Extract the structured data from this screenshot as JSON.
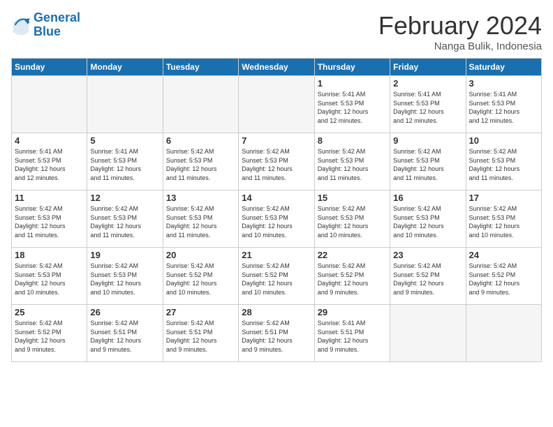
{
  "logo": {
    "line1": "General",
    "line2": "Blue"
  },
  "title": "February 2024",
  "subtitle": "Nanga Bulik, Indonesia",
  "days_of_week": [
    "Sunday",
    "Monday",
    "Tuesday",
    "Wednesday",
    "Thursday",
    "Friday",
    "Saturday"
  ],
  "weeks": [
    [
      {
        "day": "",
        "info": ""
      },
      {
        "day": "",
        "info": ""
      },
      {
        "day": "",
        "info": ""
      },
      {
        "day": "",
        "info": ""
      },
      {
        "day": "1",
        "info": "Sunrise: 5:41 AM\nSunset: 5:53 PM\nDaylight: 12 hours\nand 12 minutes."
      },
      {
        "day": "2",
        "info": "Sunrise: 5:41 AM\nSunset: 5:53 PM\nDaylight: 12 hours\nand 12 minutes."
      },
      {
        "day": "3",
        "info": "Sunrise: 5:41 AM\nSunset: 5:53 PM\nDaylight: 12 hours\nand 12 minutes."
      }
    ],
    [
      {
        "day": "4",
        "info": "Sunrise: 5:41 AM\nSunset: 5:53 PM\nDaylight: 12 hours\nand 12 minutes."
      },
      {
        "day": "5",
        "info": "Sunrise: 5:41 AM\nSunset: 5:53 PM\nDaylight: 12 hours\nand 11 minutes."
      },
      {
        "day": "6",
        "info": "Sunrise: 5:42 AM\nSunset: 5:53 PM\nDaylight: 12 hours\nand 11 minutes."
      },
      {
        "day": "7",
        "info": "Sunrise: 5:42 AM\nSunset: 5:53 PM\nDaylight: 12 hours\nand 11 minutes."
      },
      {
        "day": "8",
        "info": "Sunrise: 5:42 AM\nSunset: 5:53 PM\nDaylight: 12 hours\nand 11 minutes."
      },
      {
        "day": "9",
        "info": "Sunrise: 5:42 AM\nSunset: 5:53 PM\nDaylight: 12 hours\nand 11 minutes."
      },
      {
        "day": "10",
        "info": "Sunrise: 5:42 AM\nSunset: 5:53 PM\nDaylight: 12 hours\nand 11 minutes."
      }
    ],
    [
      {
        "day": "11",
        "info": "Sunrise: 5:42 AM\nSunset: 5:53 PM\nDaylight: 12 hours\nand 11 minutes."
      },
      {
        "day": "12",
        "info": "Sunrise: 5:42 AM\nSunset: 5:53 PM\nDaylight: 12 hours\nand 11 minutes."
      },
      {
        "day": "13",
        "info": "Sunrise: 5:42 AM\nSunset: 5:53 PM\nDaylight: 12 hours\nand 11 minutes."
      },
      {
        "day": "14",
        "info": "Sunrise: 5:42 AM\nSunset: 5:53 PM\nDaylight: 12 hours\nand 10 minutes."
      },
      {
        "day": "15",
        "info": "Sunrise: 5:42 AM\nSunset: 5:53 PM\nDaylight: 12 hours\nand 10 minutes."
      },
      {
        "day": "16",
        "info": "Sunrise: 5:42 AM\nSunset: 5:53 PM\nDaylight: 12 hours\nand 10 minutes."
      },
      {
        "day": "17",
        "info": "Sunrise: 5:42 AM\nSunset: 5:53 PM\nDaylight: 12 hours\nand 10 minutes."
      }
    ],
    [
      {
        "day": "18",
        "info": "Sunrise: 5:42 AM\nSunset: 5:53 PM\nDaylight: 12 hours\nand 10 minutes."
      },
      {
        "day": "19",
        "info": "Sunrise: 5:42 AM\nSunset: 5:53 PM\nDaylight: 12 hours\nand 10 minutes."
      },
      {
        "day": "20",
        "info": "Sunrise: 5:42 AM\nSunset: 5:52 PM\nDaylight: 12 hours\nand 10 minutes."
      },
      {
        "day": "21",
        "info": "Sunrise: 5:42 AM\nSunset: 5:52 PM\nDaylight: 12 hours\nand 10 minutes."
      },
      {
        "day": "22",
        "info": "Sunrise: 5:42 AM\nSunset: 5:52 PM\nDaylight: 12 hours\nand 9 minutes."
      },
      {
        "day": "23",
        "info": "Sunrise: 5:42 AM\nSunset: 5:52 PM\nDaylight: 12 hours\nand 9 minutes."
      },
      {
        "day": "24",
        "info": "Sunrise: 5:42 AM\nSunset: 5:52 PM\nDaylight: 12 hours\nand 9 minutes."
      }
    ],
    [
      {
        "day": "25",
        "info": "Sunrise: 5:42 AM\nSunset: 5:52 PM\nDaylight: 12 hours\nand 9 minutes."
      },
      {
        "day": "26",
        "info": "Sunrise: 5:42 AM\nSunset: 5:51 PM\nDaylight: 12 hours\nand 9 minutes."
      },
      {
        "day": "27",
        "info": "Sunrise: 5:42 AM\nSunset: 5:51 PM\nDaylight: 12 hours\nand 9 minutes."
      },
      {
        "day": "28",
        "info": "Sunrise: 5:42 AM\nSunset: 5:51 PM\nDaylight: 12 hours\nand 9 minutes."
      },
      {
        "day": "29",
        "info": "Sunrise: 5:41 AM\nSunset: 5:51 PM\nDaylight: 12 hours\nand 9 minutes."
      },
      {
        "day": "",
        "info": ""
      },
      {
        "day": "",
        "info": ""
      }
    ]
  ]
}
